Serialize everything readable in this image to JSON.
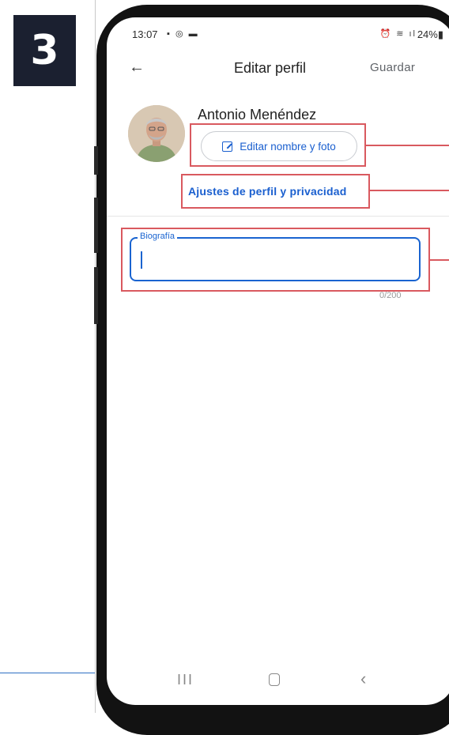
{
  "step_badge": "3",
  "status_bar": {
    "time": "13:07",
    "left_icons": "▪ ◎ ▬",
    "right_icons": "⏰ ≋ ıl",
    "battery": "24%▮"
  },
  "app_bar": {
    "back_icon": "arrow-left-icon",
    "title": "Editar perfil",
    "save_label": "Guardar"
  },
  "profile": {
    "name": "Antonio Menéndez",
    "edit_button_label": "Editar nombre y foto",
    "edit_icon": "edit-square-icon",
    "settings_link": "Ajustes de perfil y privacidad"
  },
  "bio": {
    "label": "Biografía",
    "value": "",
    "counter": "0/200"
  },
  "nav_bar": {
    "recents": "III",
    "back": "‹"
  },
  "colors": {
    "accent": "#1a64d0",
    "highlight": "#d9595f",
    "badge": "#1b2030"
  }
}
